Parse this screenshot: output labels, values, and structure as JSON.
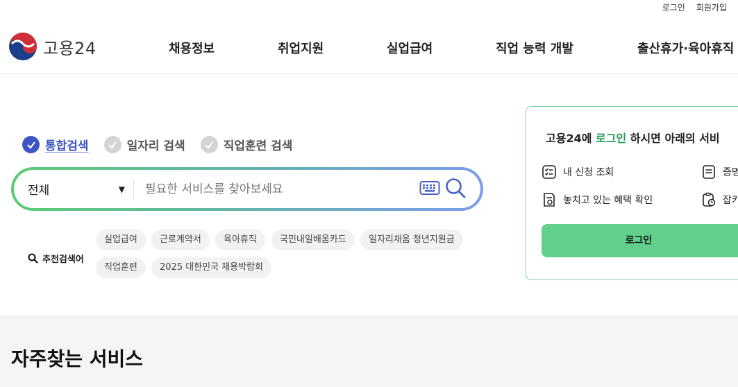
{
  "util": {
    "login": "로그인",
    "signup": "회원가입"
  },
  "logo": {
    "text": "고용24"
  },
  "gnb": [
    "채용정보",
    "취업지원",
    "실업급여",
    "직업 능력 개발",
    "출산휴가·육아휴직"
  ],
  "search_tabs": [
    {
      "label": "통합검색",
      "active": true
    },
    {
      "label": "일자리 검색",
      "active": false
    },
    {
      "label": "직업훈련 검색",
      "active": false
    }
  ],
  "search": {
    "scope": "전체",
    "placeholder": "필요한 서비스를 찾아보세요"
  },
  "recommended": {
    "label": "추천검색어",
    "keywords": [
      "실업급여",
      "근로계약서",
      "육아휴직",
      "국민내일배움카드",
      "일자리채움 청년지원금",
      "직업훈련",
      "2025 대한민국 채용박람회"
    ]
  },
  "login_card": {
    "title_pre": "고용24에 ",
    "title_highlight": "로그인",
    "title_post": " 하시면 아래의 서비",
    "items": [
      "내 신청 조회",
      "증명",
      "놓치고 있는 혜택 확인",
      "잡카"
    ],
    "button": "로그인"
  },
  "frequent": {
    "title": "자주찾는 서비스"
  },
  "colors": {
    "brand_blue": "#3e55c4",
    "brand_green": "#1d9c55",
    "login_button": "#62cf8c"
  }
}
